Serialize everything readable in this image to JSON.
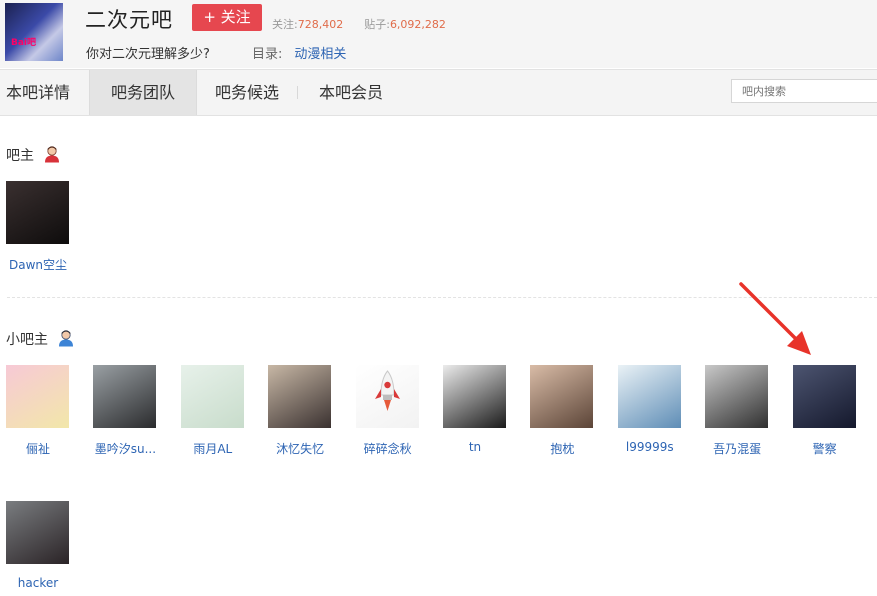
{
  "forum": {
    "name": "二次元吧",
    "avatar_text": "Bai吧",
    "follow_label": "+ 关注",
    "followers_label": "关注:",
    "followers": "728,402",
    "posts_label": "贴子:",
    "posts": "6,092,282",
    "slogan": "你对二次元理解多少?",
    "catalog_label": "目录:",
    "catalog_value": "动漫相关"
  },
  "tabs": [
    {
      "label": "本吧详情",
      "active": false
    },
    {
      "label": "吧务团队",
      "active": true
    },
    {
      "label": "吧务候选",
      "active": false
    },
    {
      "label": "本吧会员",
      "active": false
    }
  ],
  "search": {
    "placeholder": "吧内搜索"
  },
  "owners": {
    "title": "吧主",
    "icon": "owner-red-user-icon",
    "members": [
      {
        "name": "Dawn空尘",
        "avatar_colors": [
          "#3a3030",
          "#0e0c0c"
        ]
      }
    ]
  },
  "assistants": {
    "title": "小吧主",
    "icon": "assistant-blue-user-icon",
    "members": [
      {
        "name": "俪祉",
        "avatar_colors": [
          "#f7c9d6",
          "#f2e7a9"
        ]
      },
      {
        "name": "墨吟汐su...",
        "avatar_colors": [
          "#9aa0a4",
          "#2a2b2d"
        ]
      },
      {
        "name": "雨月AL",
        "avatar_colors": [
          "#e7f1ea",
          "#c8dccb"
        ]
      },
      {
        "name": "沐忆失忆",
        "avatar_colors": [
          "#c8b8a6",
          "#3a3130"
        ]
      },
      {
        "name": "碎碎念秋",
        "avatar_colors": [
          "#ffffff",
          "#f2f2f2"
        ]
      },
      {
        "name": "tn",
        "avatar_colors": [
          "#ececec",
          "#1a1a1a"
        ]
      },
      {
        "name": "抱枕",
        "avatar_colors": [
          "#d9bca7",
          "#5b4437"
        ]
      },
      {
        "name": "l99999s",
        "avatar_colors": [
          "#eaf2f6",
          "#5e8db6"
        ]
      },
      {
        "name": "吾乃混蛋",
        "avatar_colors": [
          "#c9c9c9",
          "#2f2f2f"
        ]
      },
      {
        "name": "警察",
        "avatar_colors": [
          "#4d5571",
          "#14182c"
        ]
      },
      {
        "name": "hacker",
        "avatar_colors": [
          "#7a7d80",
          "#2a2326"
        ]
      }
    ]
  },
  "colors": {
    "accent_red": "#e6474f",
    "link_blue": "#2d64b3",
    "stat_orange": "#e06c4a",
    "annotation_arrow": "#e8332a"
  }
}
